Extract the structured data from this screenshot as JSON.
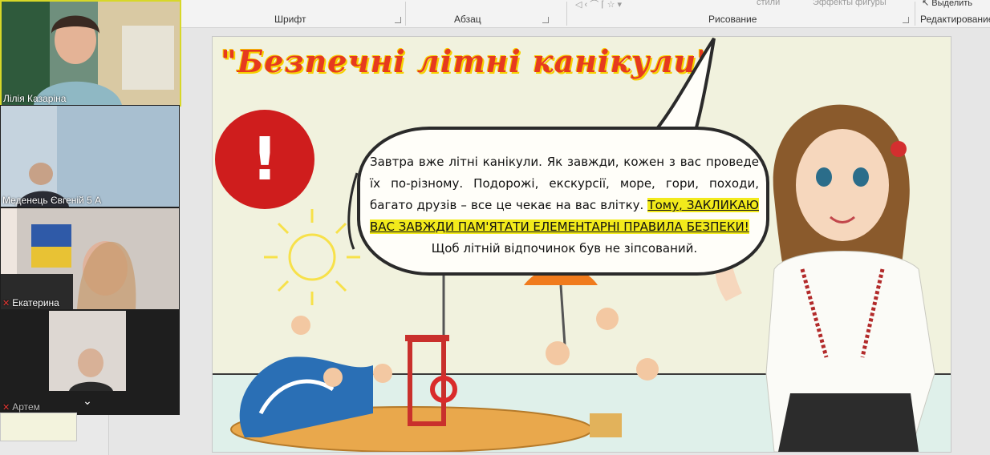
{
  "ribbon": {
    "groups": [
      "Шрифт",
      "Абзац",
      "Рисование",
      "Редактирование"
    ],
    "styles_label": "стили",
    "effects_label": "Эффекты фигуры",
    "select_label": "Выделить"
  },
  "slide": {
    "title": "\"Безпечні літні канікули\"",
    "warning_symbol": "!",
    "bubble": {
      "p1": "Завтра вже літні канікули. Як завжди, кожен з вас проведе їх по-різному. Подорожі, екскурсії, море, гори, походи, багато друзів – все це чекає на вас влітку. ",
      "p2_hl1": "Тому",
      "p2_hl2": ", ЗАКЛИКАЮ ВАС ЗАВЖДИ ПАМ'ЯТАТИ ЕЛЕМЕНТАРНІ ПРАВИЛА БЕЗПЕКИ!",
      "p3": "Щоб літній відпочинок був не зіпсований."
    }
  },
  "participants": [
    {
      "name": "Лілія Казаріна",
      "muted": false
    },
    {
      "name": "Меденець Євгеній 5 А",
      "muted": false
    },
    {
      "name": "Екатерина",
      "muted": true
    },
    {
      "name": "Артем",
      "muted": true
    }
  ],
  "colors": {
    "title": "#e63a1f",
    "title_outline": "#f6d000",
    "warning": "#cf1d1d",
    "highlight": "#f2ea1b",
    "slide_bg": "#f1f2de"
  }
}
